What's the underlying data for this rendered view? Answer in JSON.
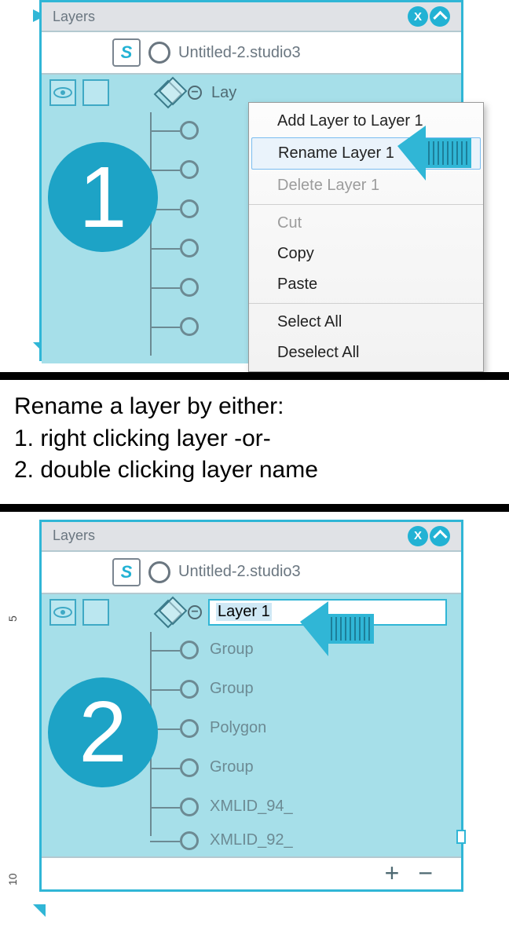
{
  "panel1": {
    "title": "Layers",
    "doc_name": "Untitled-2.studio3",
    "layer_label": "Lay",
    "step": "1",
    "menu": {
      "add": "Add Layer to Layer 1",
      "rename": "Rename Layer 1",
      "delete": "Delete Layer 1",
      "cut": "Cut",
      "copy": "Copy",
      "paste": "Paste",
      "select_all": "Select All",
      "deselect_all": "Deselect All"
    }
  },
  "caption": {
    "l1": "Rename a layer by either:",
    "l2": "1. right clicking layer -or-",
    "l3": "2. double clicking layer name"
  },
  "panel2": {
    "title": "Layers",
    "doc_name": "Untitled-2.studio3",
    "layer_label": "Layer 1",
    "step": "2",
    "children": [
      "Group",
      "Group",
      "Polygon",
      "Group",
      "XMLID_94_",
      "XMLID_92_"
    ],
    "footer": {
      "plus": "+",
      "minus": "−"
    }
  }
}
